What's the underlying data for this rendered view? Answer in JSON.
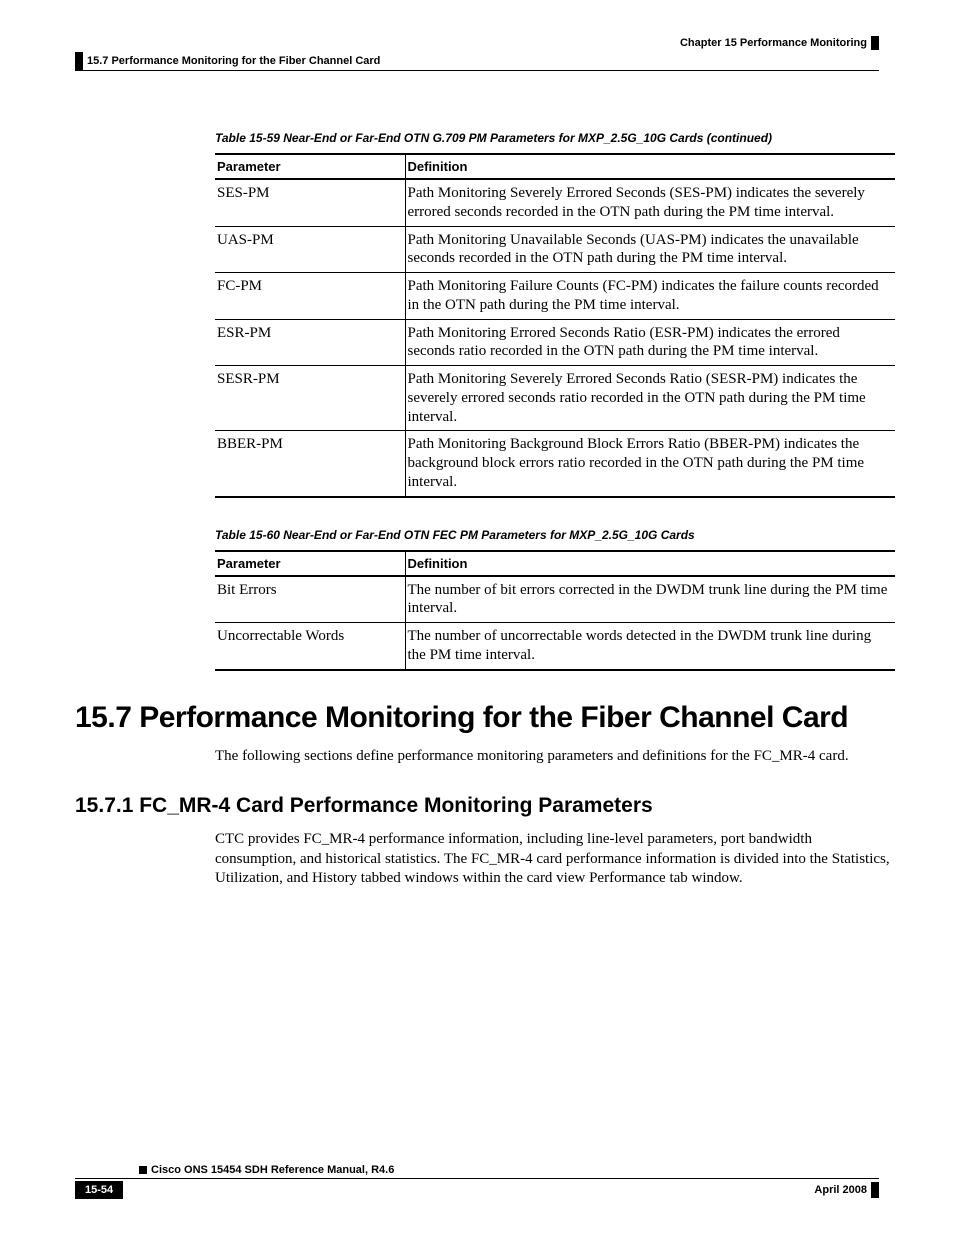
{
  "header": {
    "chapter": "Chapter 15      Performance Monitoring",
    "section": "15.7  Performance Monitoring for the Fiber Channel Card"
  },
  "table59": {
    "caption": "Table 15-59 Near-End or Far-End OTN G.709 PM Parameters for MXP_2.5G_10G Cards (continued)",
    "head_param": "Parameter",
    "head_def": "Definition",
    "rows": [
      {
        "p": "SES-PM",
        "d": "Path Monitoring Severely Errored Seconds (SES-PM) indicates the severely errored seconds recorded in the OTN path during the PM time interval."
      },
      {
        "p": "UAS-PM",
        "d": "Path Monitoring Unavailable Seconds (UAS-PM) indicates the unavailable seconds recorded in the OTN path during the PM time interval."
      },
      {
        "p": "FC-PM",
        "d": "Path Monitoring Failure Counts (FC-PM) indicates the failure counts recorded in the OTN path during the PM time interval."
      },
      {
        "p": "ESR-PM",
        "d": "Path Monitoring Errored Seconds Ratio (ESR-PM) indicates the errored seconds ratio recorded in the OTN path during the PM time interval."
      },
      {
        "p": "SESR-PM",
        "d": "Path Monitoring Severely Errored Seconds Ratio (SESR-PM) indicates the severely errored seconds ratio recorded in the OTN path during the PM time interval."
      },
      {
        "p": "BBER-PM",
        "d": "Path Monitoring Background Block Errors Ratio (BBER-PM) indicates the background block errors ratio recorded in the OTN path during the PM time interval."
      }
    ]
  },
  "table60": {
    "caption": "Table 15-60 Near-End or Far-End OTN FEC PM Parameters for MXP_2.5G_10G Cards",
    "head_param": "Parameter",
    "head_def": "Definition",
    "rows": [
      {
        "p": "Bit Errors",
        "d": "The number of bit errors corrected in the DWDM trunk line during the PM time interval."
      },
      {
        "p": "Uncorrectable Words",
        "d": "The number of uncorrectable words detected in the DWDM trunk line during the PM time interval."
      }
    ]
  },
  "section": {
    "h1": "15.7  Performance Monitoring for the Fiber Channel Card",
    "p1": "The following sections define performance monitoring parameters and definitions for the FC_MR-4 card.",
    "h2": "15.7.1  FC_MR-4 Card Performance Monitoring Parameters",
    "p2": "CTC provides FC_MR-4 performance information, including line-level parameters, port bandwidth consumption, and historical statistics. The FC_MR-4 card performance information is divided into the Statistics, Utilization, and History tabbed windows within the card view Performance tab window."
  },
  "footer": {
    "manual": "Cisco ONS 15454 SDH Reference Manual, R4.6",
    "page": "15-54",
    "date": "April 2008"
  }
}
